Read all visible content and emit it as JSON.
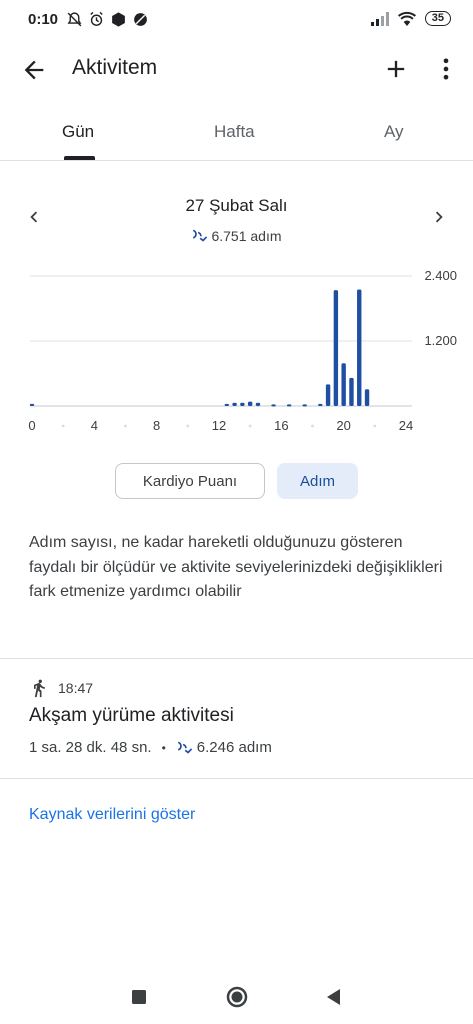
{
  "status_bar": {
    "time": "0:10",
    "battery": "35"
  },
  "app_bar": {
    "title": "Aktivitem"
  },
  "tabs": [
    {
      "label": "Gün",
      "active": true
    },
    {
      "label": "Hafta",
      "active": false
    },
    {
      "label": "Ay",
      "active": false
    }
  ],
  "day": {
    "date": "27 Şubat Salı",
    "steps": "6.751 adım"
  },
  "chart_data": {
    "type": "bar",
    "x_tick_labels": [
      "0",
      "4",
      "8",
      "12",
      "16",
      "20",
      "24"
    ],
    "y_tick_labels": [
      "1.200",
      "2.400"
    ],
    "ylim": [
      0,
      2400
    ],
    "xlim": [
      0,
      24
    ],
    "x": [
      0,
      12.5,
      13,
      13.5,
      14,
      14.5,
      15.5,
      16.5,
      17.5,
      18.5,
      19,
      19.5,
      20,
      20.5,
      21,
      21.5
    ],
    "values": [
      40,
      40,
      60,
      60,
      80,
      60,
      30,
      30,
      30,
      40,
      400,
      2140,
      790,
      520,
      2150,
      310
    ],
    "color": "#1f4fa3"
  },
  "chips": {
    "cardio": "Kardiyo Puanı",
    "steps": "Adım"
  },
  "description": "Adım sayısı, ne kadar hareketli olduğunuzu gösteren faydalı bir ölçüdür ve aktivite seviyelerinizdeki değişiklikleri fark etmenize yardımcı olabilir",
  "activity": {
    "time": "18:47",
    "title": "Akşam yürüme aktivitesi",
    "duration": "1 sa. 28 dk. 48 sn.",
    "separator": "•",
    "steps": "6.246 adım"
  },
  "source_link": "Kaynak verilerini göster",
  "icons": [
    "back-arrow-icon",
    "plus-icon",
    "more-vert-icon",
    "chevron-left-icon",
    "chevron-right-icon",
    "steps-icon",
    "walking-icon"
  ]
}
